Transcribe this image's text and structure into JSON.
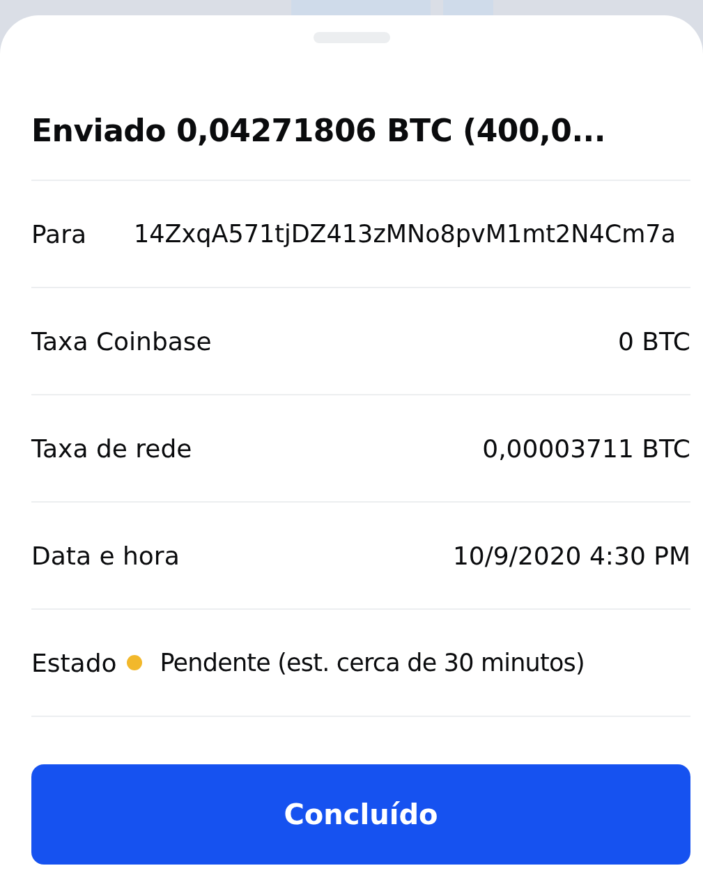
{
  "title": "Enviado 0,04271806 BTC (400,0...",
  "rows": [
    {
      "kind": "text",
      "label": "Para",
      "value": "14ZxqA571tjDZ413zMNo8pvM1mt2N4Cm7a"
    },
    {
      "kind": "text",
      "label": "Taxa Coinbase",
      "value": "0 BTC"
    },
    {
      "kind": "text",
      "label": "Taxa de rede",
      "value": "0,00003711 BTC"
    },
    {
      "kind": "text",
      "label": "Data e hora",
      "value": "10/9/2020 4:30 PM"
    },
    {
      "kind": "status",
      "label": "Estado",
      "value": "Pendente (est. cerca de 30 minutos)",
      "color": "#f2b82b"
    }
  ],
  "button": "Concluído"
}
